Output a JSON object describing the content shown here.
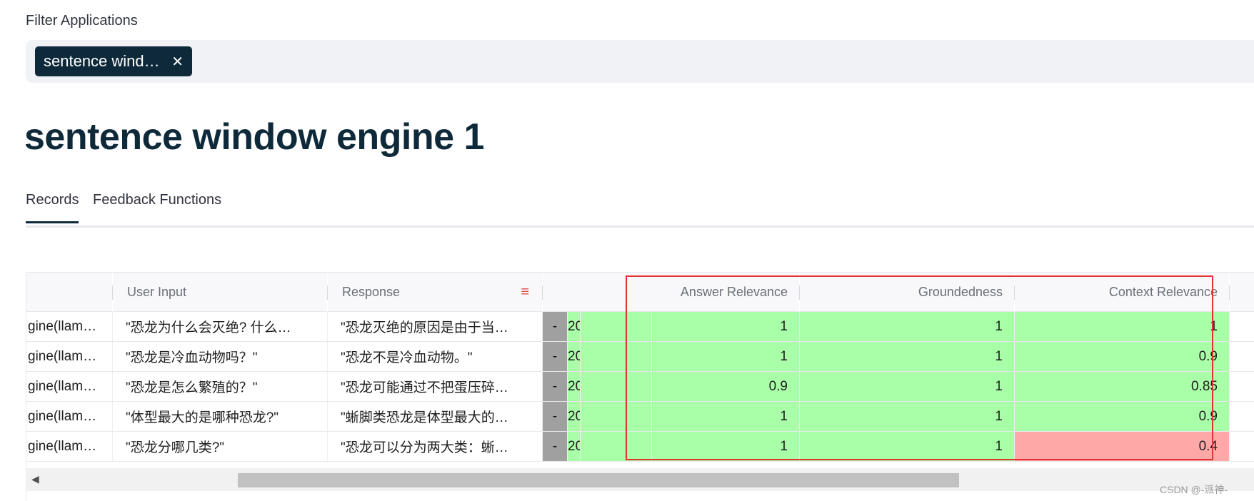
{
  "filter": {
    "label": "Filter Applications",
    "chip_text": "sentence windo…",
    "chip_close": "✕"
  },
  "page_title": "sentence window engine 1",
  "tabs": [
    {
      "label": "Records",
      "active": true
    },
    {
      "label": "Feedback Functions",
      "active": false
    }
  ],
  "table": {
    "headers": {
      "user_input": "User Input",
      "response": "Response",
      "answer_relevance": "Answer Relevance",
      "groundedness": "Groundedness",
      "context_relevance": "Context Relevance"
    },
    "rows": [
      {
        "app": "gine(llama…",
        "input": "\"恐龙为什么会灭绝? 什么…",
        "response": "\"恐龙灭绝的原因是由于当…",
        "dash": "-",
        "ts": "20",
        "answer": "1",
        "ground": "1",
        "context": "1",
        "context_status": "good"
      },
      {
        "app": "gine(llama…",
        "input": "\"恐龙是冷血动物吗？\"",
        "response": "\"恐龙不是冷血动物。\"",
        "dash": "-",
        "ts": "20",
        "answer": "1",
        "ground": "1",
        "context": "0.9",
        "context_status": "good"
      },
      {
        "app": "gine(llama…",
        "input": "\"恐龙是怎么繁殖的？\"",
        "response": "\"恐龙可能通过不把蛋压碎…",
        "dash": "-",
        "ts": "20",
        "answer": "0.9",
        "ground": "1",
        "context": "0.85",
        "context_status": "good"
      },
      {
        "app": "gine(llama…",
        "input": "\"体型最大的是哪种恐龙?\"",
        "response": "\"蜥脚类恐龙是体型最大的…",
        "dash": "-",
        "ts": "20",
        "answer": "1",
        "ground": "1",
        "context": "0.9",
        "context_status": "good"
      },
      {
        "app": "gine(llama…",
        "input": "\"恐龙分哪几类?\"",
        "response": "\"恐龙可以分为两大类：蜥…",
        "dash": "-",
        "ts": "20",
        "answer": "1",
        "ground": "1",
        "context": "0.4",
        "context_status": "bad"
      }
    ]
  },
  "scrollbar": {
    "left_arrow": "◀"
  },
  "watermark": "CSDN @-派神-",
  "colors": {
    "good": "#a8ffa8",
    "bad": "#ffa8a8",
    "highlight": "#e33232",
    "chip": "#0e2a3a"
  },
  "icons": {
    "menu": "hamburger-menu-icon",
    "close": "close-icon"
  }
}
